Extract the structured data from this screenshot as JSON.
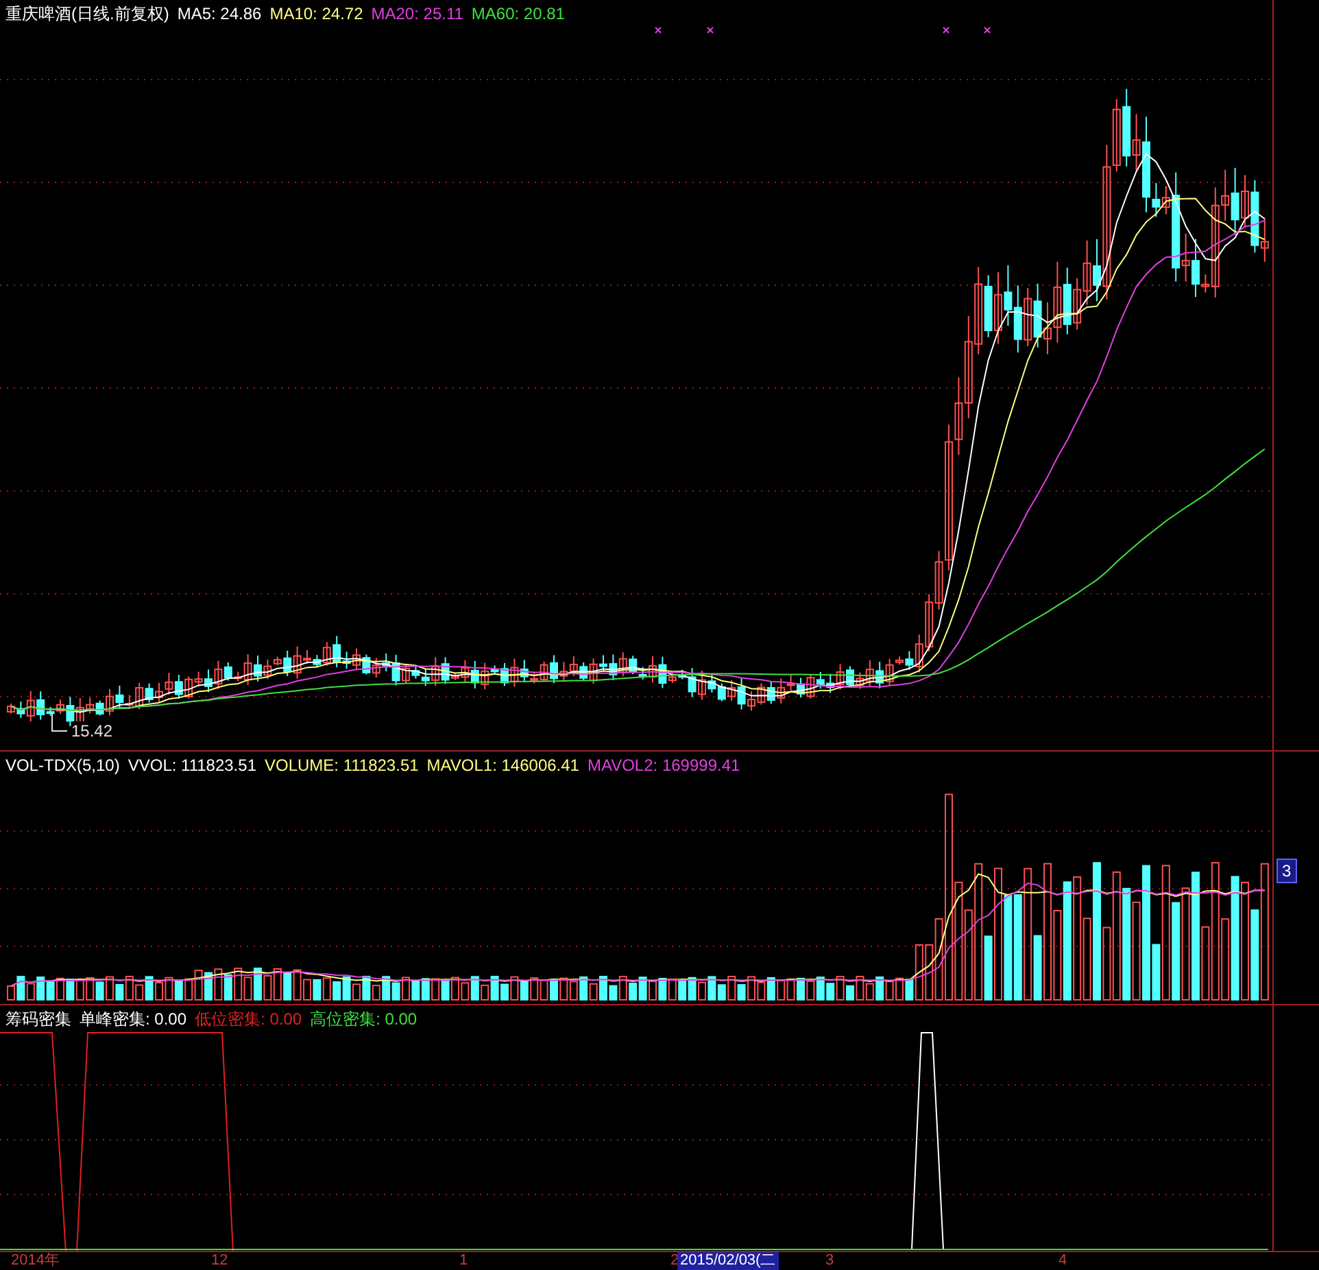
{
  "main_panel": {
    "title": "重庆啤酒(日线.前复权)",
    "ma": [
      {
        "label": "MA5: 24.86",
        "color": "#ffffff"
      },
      {
        "label": "MA10: 24.72",
        "color": "#ffff80"
      },
      {
        "label": "MA20: 25.11",
        "color": "#e040e0"
      },
      {
        "label": "MA60: 20.81",
        "color": "#40e040"
      }
    ],
    "low_marker": "15.42"
  },
  "volume_panel": {
    "items": [
      {
        "label": "VOL-TDX(5,10)",
        "color": "#ffffff"
      },
      {
        "label": "VVOL: 111823.51",
        "color": "#ffffff"
      },
      {
        "label": "VOLUME: 111823.51",
        "color": "#ffff80"
      },
      {
        "label": "MAVOL1: 146006.41",
        "color": "#ffff80"
      },
      {
        "label": "MAVOL2: 169999.41",
        "color": "#e040e0"
      }
    ],
    "axis_badge": "3"
  },
  "indicator_panel": {
    "items": [
      {
        "label": "筹码密集",
        "color": "#ffffff"
      },
      {
        "label": "单峰密集: 0.00",
        "color": "#ffffff"
      },
      {
        "label": "低位密集: 0.00",
        "color": "#e02020"
      },
      {
        "label": "高位密集: 0.00",
        "color": "#40e040"
      }
    ]
  },
  "time_axis": {
    "labels": [
      {
        "text": "2014年",
        "selected": false
      },
      {
        "text": "12",
        "selected": false
      },
      {
        "text": "1",
        "selected": false
      },
      {
        "text": "2",
        "selected": false
      },
      {
        "text": "2015/02/03(二",
        "selected": true
      },
      {
        "text": "3",
        "selected": false
      },
      {
        "text": "4",
        "selected": false
      }
    ]
  }
}
